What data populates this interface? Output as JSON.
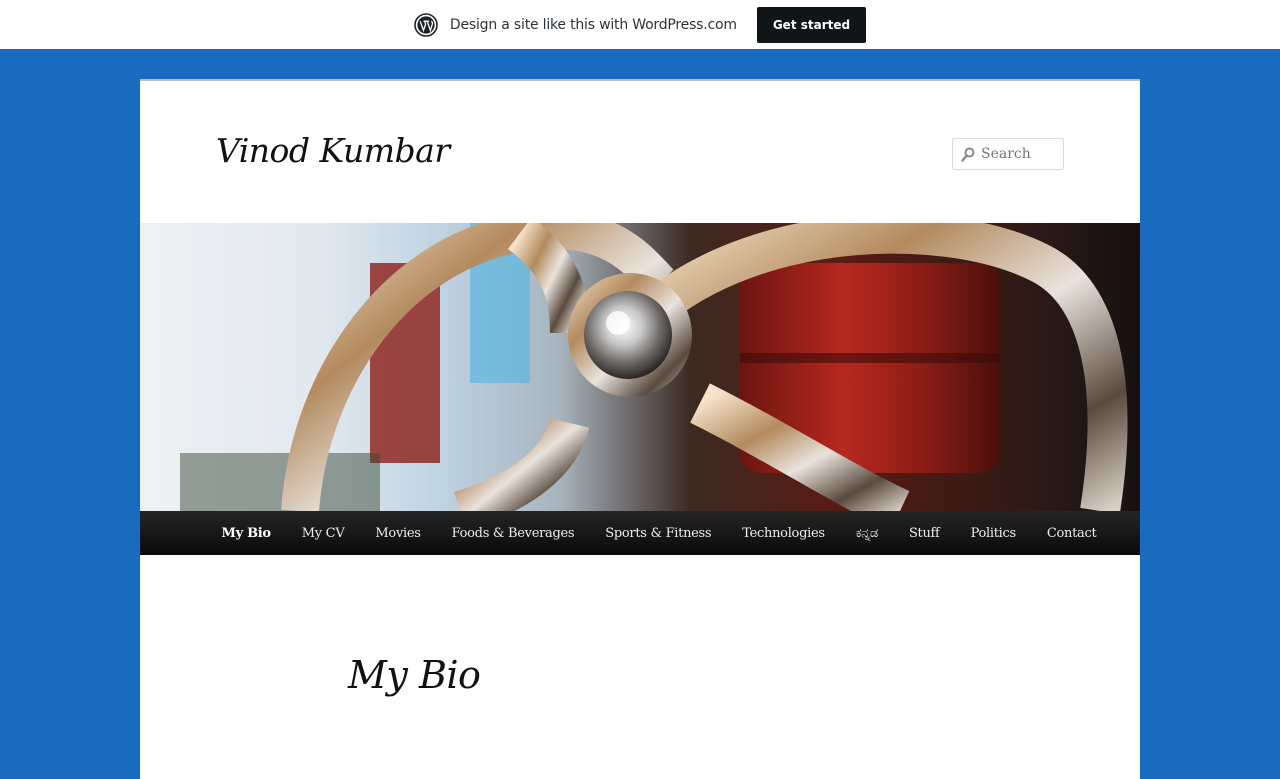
{
  "promo": {
    "text": "Design a site like this with WordPress.com",
    "button_label": "Get started",
    "logo_icon": "wordpress-logo-icon"
  },
  "site": {
    "title": "Vinod Kumbar"
  },
  "search": {
    "placeholder": "Search",
    "icon": "search-icon"
  },
  "nav": {
    "items": [
      {
        "label": "My Bio",
        "active": true
      },
      {
        "label": "My CV"
      },
      {
        "label": "Movies"
      },
      {
        "label": "Foods & Beverages"
      },
      {
        "label": "Sports & Fitness"
      },
      {
        "label": "Technologies"
      },
      {
        "label": "ಕನ್ನಡ"
      },
      {
        "label": "Stuff"
      },
      {
        "label": "Politics"
      },
      {
        "label": "Contact"
      }
    ]
  },
  "page": {
    "title": "My Bio"
  },
  "colors": {
    "background": "#1a6bbf",
    "nav_background": "#111111",
    "promo_button": "#101517"
  }
}
